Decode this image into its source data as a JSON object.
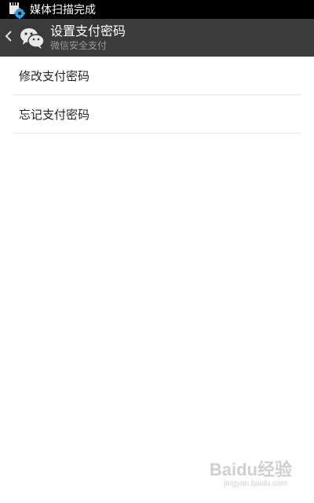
{
  "status_bar": {
    "notification_text": "媒体扫描完成",
    "icon": "sd-card-gear-icon"
  },
  "action_bar": {
    "title": "设置支付密码",
    "subtitle": "微信安全支付",
    "back_icon": "chevron-left-icon",
    "logo_icon": "wechat-logo-icon"
  },
  "menu": {
    "items": [
      {
        "label": "修改支付密码"
      },
      {
        "label": "忘记支付密码"
      }
    ]
  },
  "watermark": {
    "main": "Baidu经验",
    "sub": "jingyan.baidu.com"
  },
  "colors": {
    "status_bar_bg": "#000000",
    "action_bar_bg": "#3b3b3b",
    "page_bg": "#ffffff",
    "divider": "#e6e6e6"
  }
}
